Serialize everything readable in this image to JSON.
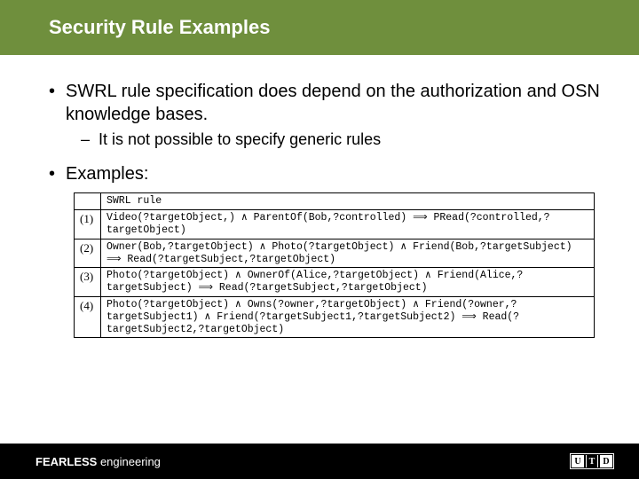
{
  "title": "Security Rule Examples",
  "bullets": {
    "b1": "SWRL rule specification does depend on the authorization and OSN knowledge bases.",
    "b1a": "It is not possible to specify generic rules",
    "b2": "Examples:"
  },
  "table": {
    "header": "SWRL rule",
    "rows": [
      {
        "idx": "(1)",
        "rule": "Video(?targetObject,) ∧ ParentOf(Bob,?controlled) ⟹ PRead(?controlled,?targetObject)"
      },
      {
        "idx": "(2)",
        "rule": "Owner(Bob,?targetObject) ∧ Photo(?targetObject) ∧ Friend(Bob,?targetSubject) ⟹ Read(?targetSubject,?targetObject)"
      },
      {
        "idx": "(3)",
        "rule": "Photo(?targetObject) ∧ OwnerOf(Alice,?targetObject) ∧ Friend(Alice,?targetSubject) ⟹ Read(?targetSubject,?targetObject)"
      },
      {
        "idx": "(4)",
        "rule": "Photo(?targetObject) ∧ Owns(?owner,?targetObject) ∧ Friend(?owner,?targetSubject1) ∧ Friend(?targetSubject1,?targetSubject2) ⟹ Read(?targetSubject2,?targetObject)"
      }
    ]
  },
  "footer": {
    "brand_bold": "FEARLESS",
    "brand_light": " engineering",
    "logo": {
      "u": "U",
      "t": "T",
      "d": "D"
    }
  }
}
